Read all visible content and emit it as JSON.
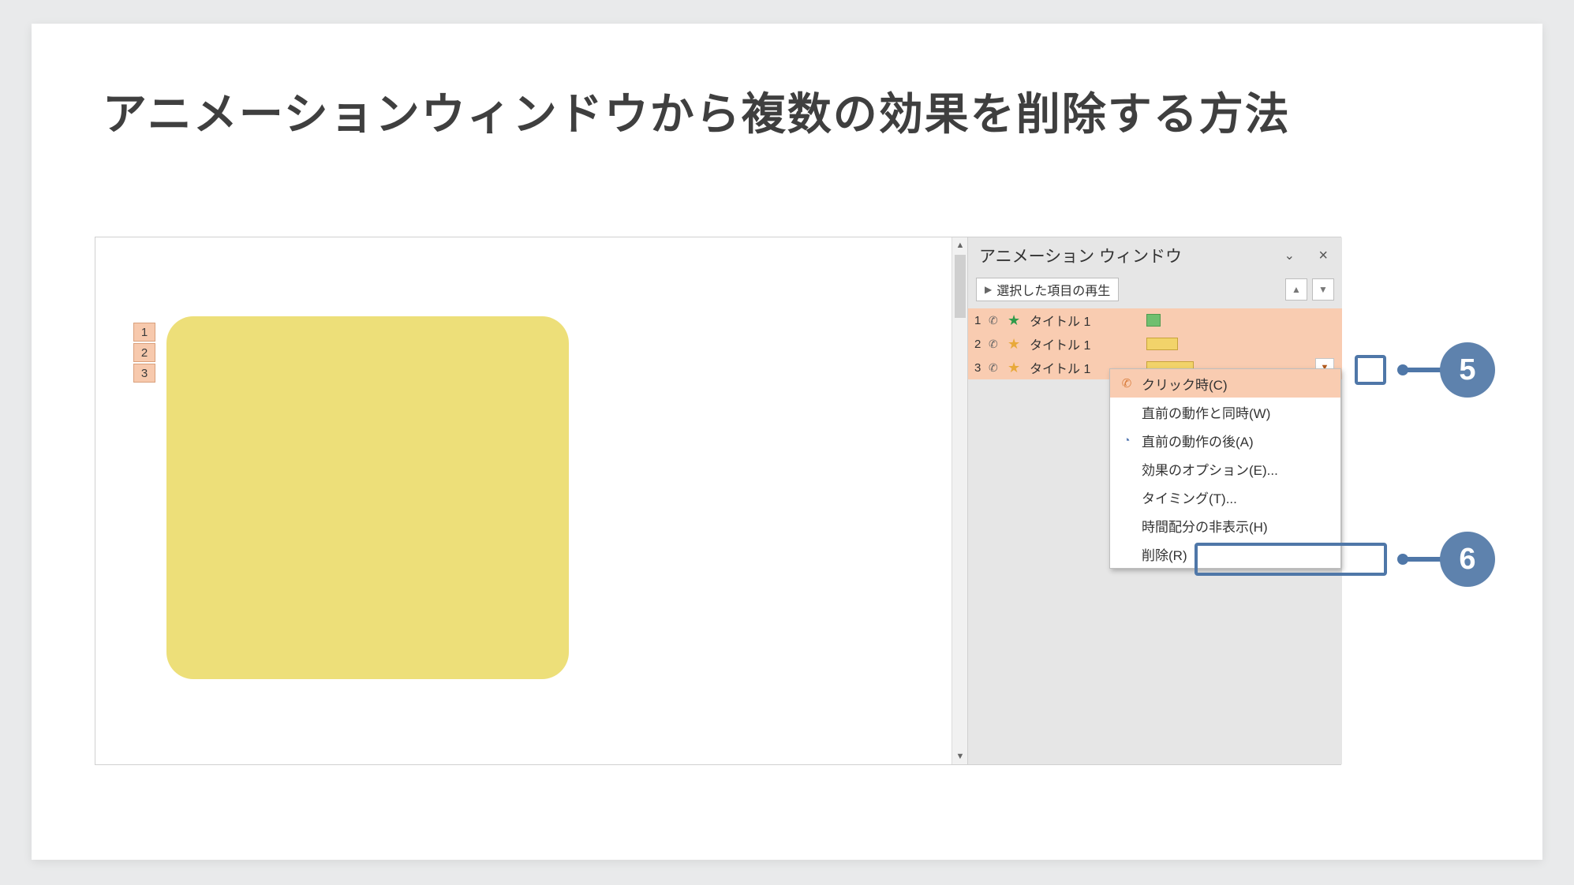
{
  "title": "アニメーションウィンドウから複数の効果を削除する方法",
  "slide_tags": [
    "1",
    "2",
    "3"
  ],
  "pane": {
    "title": "アニメーション ウィンドウ",
    "play_button": "選択した項目の再生",
    "items": [
      {
        "num": "1",
        "label": "タイトル 1",
        "star": "green",
        "bar": "g"
      },
      {
        "num": "2",
        "label": "タイトル 1",
        "star": "orange",
        "bar": "y1"
      },
      {
        "num": "3",
        "label": "タイトル 1",
        "star": "orange",
        "bar": "y2"
      }
    ]
  },
  "context_menu": {
    "click": "クリック時(C)",
    "with_prev": "直前の動作と同時(W)",
    "after_prev": "直前の動作の後(A)",
    "effect_opts": "効果のオプション(E)...",
    "timing": "タイミング(T)...",
    "hide_timing": "時間配分の非表示(H)",
    "remove": "削除(R)"
  },
  "badge5": "5",
  "badge6": "6"
}
